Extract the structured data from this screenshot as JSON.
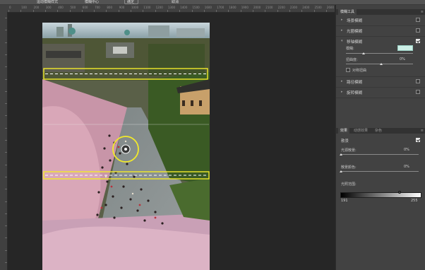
{
  "option_bar": {
    "items": [
      "运动模糊样式",
      "模糊中心",
      "确定",
      "取消"
    ]
  },
  "rulers": {
    "corner_glyph": "◤",
    "top_ticks": [
      "0",
      "100",
      "200",
      "300",
      "400",
      "500",
      "600",
      "700",
      "800",
      "900",
      "1000",
      "1100",
      "1200",
      "1300",
      "1400",
      "1500",
      "1600",
      "1700",
      "1800",
      "1900",
      "2000",
      "2100",
      "2200",
      "2300",
      "2400",
      "2500",
      "2600"
    ]
  },
  "blur_tools_panel": {
    "tab_label": "模糊工具",
    "menu_glyph": "≡",
    "rows": [
      {
        "label": "场景模糊",
        "checked": false
      },
      {
        "label": "光圈模糊",
        "checked": false
      },
      {
        "label": "移轴模糊",
        "checked": true
      },
      {
        "label": "路径模糊",
        "checked": false
      },
      {
        "label": "旋转模糊",
        "checked": false
      }
    ],
    "tilt_shift": {
      "blur_label": "模糊:",
      "blur_value": "",
      "distortion_label": "扭曲度:",
      "distortion_value": "0%",
      "symmetric_label": "对称扭曲",
      "symmetric_checked": false
    }
  },
  "effects_panel": {
    "tabs": [
      "效果",
      "动感效果",
      "杂色"
    ],
    "menu_glyph": "≡",
    "bokeh": {
      "label": "散景",
      "checked": true,
      "light_bokeh_label": "光源散景:",
      "light_bokeh_value": "0%",
      "bokeh_color_label": "散景颜色:",
      "bokeh_color_value": "0%",
      "light_range_label": "光照范围:",
      "range_min": "191",
      "range_max": "255"
    }
  },
  "colors": {
    "overlay_yellow": "#f2ea2a",
    "panel_bg": "#424242",
    "canvas_bg": "#262626"
  }
}
